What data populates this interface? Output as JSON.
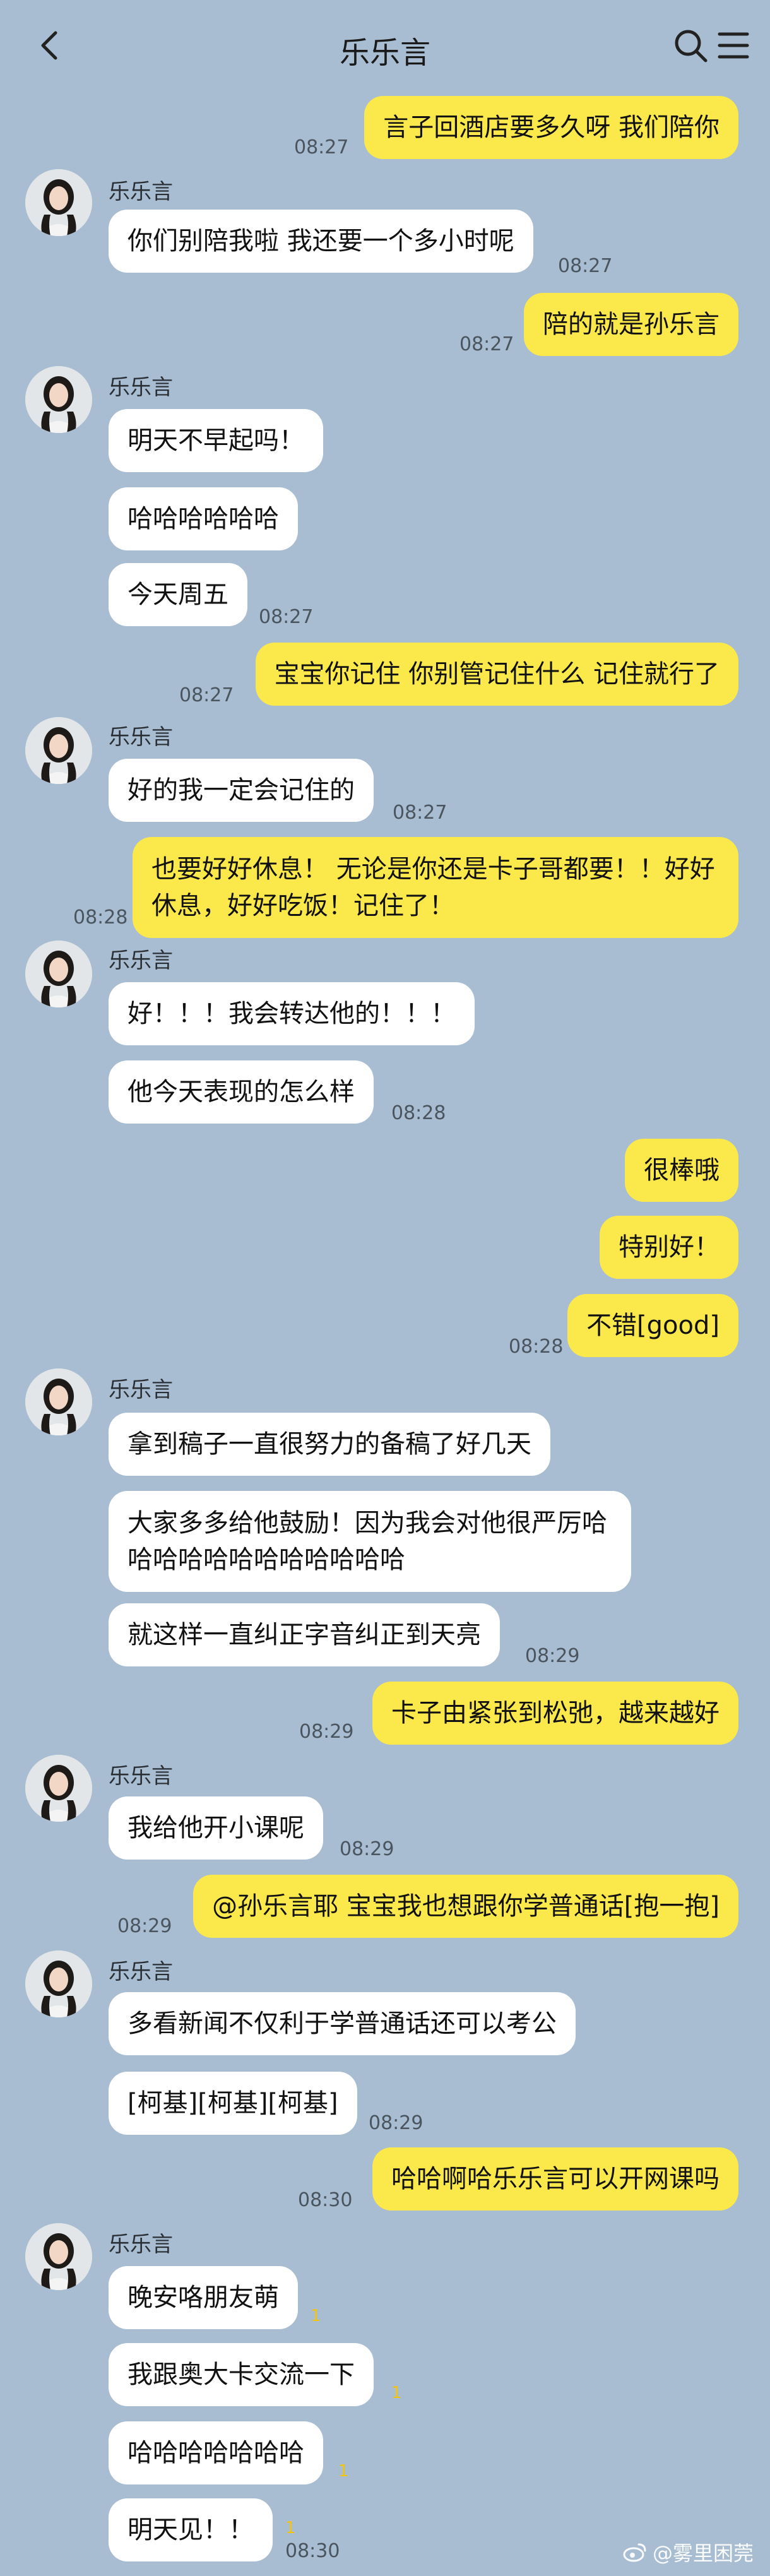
{
  "header": {
    "title": "乐乐言"
  },
  "contact": {
    "name": "乐乐言"
  },
  "messages": {
    "m1": {
      "text": "言子回酒店要多久呀 我们陪你",
      "time": "08:27"
    },
    "m2": {
      "text": "你们别陪我啦 我还要一个多小时呢",
      "time": "08:27"
    },
    "m3": {
      "text": "陪的就是孙乐言",
      "time": "08:27"
    },
    "m4": {
      "text": "明天不早起吗！"
    },
    "m5": {
      "text": "哈哈哈哈哈哈"
    },
    "m6": {
      "text": "今天周五",
      "time": "08:27"
    },
    "m7": {
      "text": "宝宝你记住 你别管记住什么 记住就行了",
      "time": "08:27"
    },
    "m8": {
      "text": "好的我一定会记住的",
      "time": "08:27"
    },
    "m9": {
      "text": "也要好好休息！ 无论是你还是卡子哥都要！！好好休息，好好吃饭！记住了！",
      "time": "08:28"
    },
    "m10": {
      "text": "好！！！我会转达他的！！！"
    },
    "m11": {
      "text": "他今天表现的怎么样",
      "time": "08:28"
    },
    "m12": {
      "text": "很棒哦"
    },
    "m13": {
      "text": "特别好！"
    },
    "m14": {
      "text": "不错[good]",
      "time": "08:28"
    },
    "m15": {
      "text": "拿到稿子一直很努力的备稿了好几天"
    },
    "m16": {
      "text": "大家多多给他鼓励！因为我会对他很严厉哈哈哈哈哈哈哈哈哈哈哈哈"
    },
    "m17": {
      "text": "就这样一直纠正字音纠正到天亮",
      "time": "08:29"
    },
    "m18": {
      "text": "卡子由紧张到松弛，越来越好",
      "time": "08:29"
    },
    "m19": {
      "text": "我给他开小课呢",
      "time": "08:29"
    },
    "m20": {
      "text": "@孙乐言耶 宝宝我也想跟你学普通话[抱一抱]",
      "time": "08:29"
    },
    "m21": {
      "text": "多看新闻不仅利于学普通话还可以考公"
    },
    "m22": {
      "text": "[柯基][柯基][柯基]",
      "time": "08:29"
    },
    "m23": {
      "text": "哈哈啊哈乐乐言可以开网课吗",
      "time": "08:30"
    },
    "m24": {
      "text": "晚安咯朋友萌",
      "tick": "1"
    },
    "m25": {
      "text": "我跟奥大卡交流一下",
      "tick": "1"
    },
    "m26": {
      "text": "哈哈哈哈哈哈哈",
      "tick": "1"
    },
    "m27": {
      "text": "明天见！！",
      "tick": "1",
      "time": "08:30"
    }
  },
  "watermark": {
    "text": "@雾里困莞"
  }
}
